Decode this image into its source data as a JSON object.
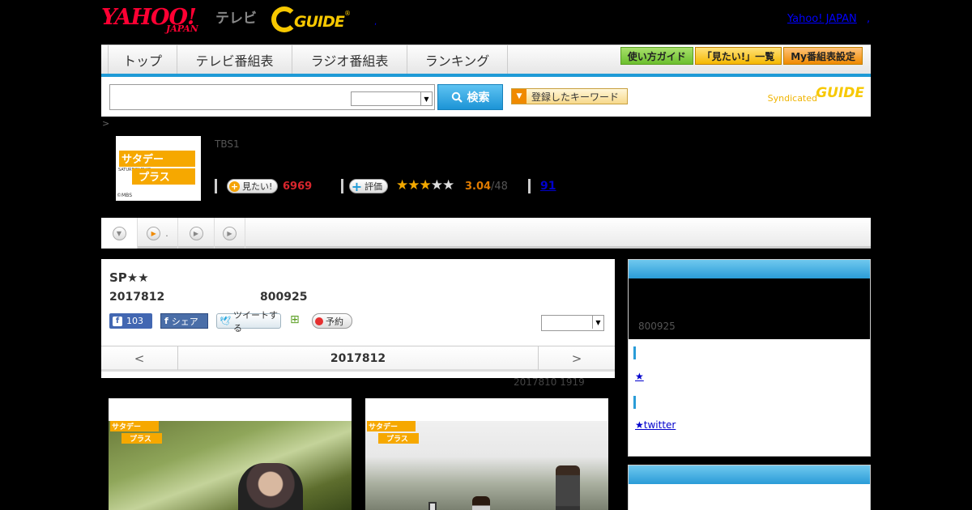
{
  "header": {
    "yahoo_logo": "YAHOO!",
    "yahoo_japan": "JAPAN",
    "tv_label": "テレビ",
    "gguide_logo": "GUIDE",
    "gguide_reg": "®",
    "dot": ",",
    "yahoo_japan_link": "Yahoo! JAPAN",
    "trailing_dot": ","
  },
  "nav": {
    "tabs": [
      {
        "label": "トップ"
      },
      {
        "label": "テレビ番組表"
      },
      {
        "label": "ラジオ番組表"
      },
      {
        "label": "ランキング"
      }
    ],
    "guide_buttons": [
      {
        "label": "使い方ガイド"
      },
      {
        "label": "「見たい!」一覧"
      },
      {
        "label": "My番組表設定"
      }
    ]
  },
  "search": {
    "input_value": "",
    "select_value": "",
    "search_button": "検索",
    "keyword_button": "登録したキーワード",
    "syndicated_label": "Syndicated",
    "syndicated_logo": "GUIDE"
  },
  "breadcrumb": ">",
  "program": {
    "thumb_line1": "サタデー",
    "thumb_line2": "プラス",
    "thumb_caption": "SATURDAY PLUS",
    "thumb_credit": "©MBS",
    "channel": "TBS1",
    "want_label": "見たい!",
    "want_count": "6969",
    "rate_label": "評価",
    "rating": 3.04,
    "rating_text": "3.04",
    "rating_of": "/48",
    "review_count": "91"
  },
  "subtabs": [
    {
      "label": ""
    },
    {
      "label": "."
    },
    {
      "label": ""
    },
    {
      "label": ""
    }
  ],
  "main": {
    "title": "SP★★",
    "date": "2017812",
    "time": "800925",
    "fb_like_count": "103",
    "fb_share": "シェア",
    "tweet": "ツイートする",
    "reserve": "予約",
    "select_value": "",
    "prev": "<",
    "nav_date": "2017812",
    "next": ">",
    "updated": "2017810  1919"
  },
  "photos": {
    "logo_line1": "サタデー",
    "logo_line2": "プラス"
  },
  "sidebar": {
    "time": "800925",
    "link1": "★",
    "link2": "★twitter"
  }
}
